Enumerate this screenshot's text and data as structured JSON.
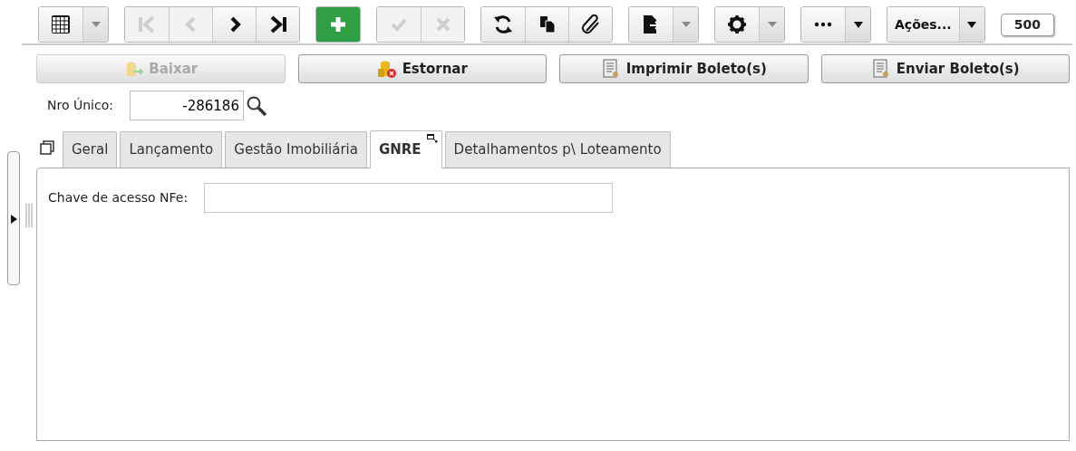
{
  "toolbar": [
    {
      "buttons": [
        {
          "kind": "icon",
          "disabled": false
        },
        {
          "kind": "caret",
          "disabled": false
        }
      ]
    },
    {
      "buttons": [
        {
          "kind": "icon",
          "disabled": true
        },
        {
          "kind": "icon",
          "disabled": true
        },
        {
          "kind": "icon",
          "disabled": false
        },
        {
          "kind": "icon",
          "disabled": false
        }
      ]
    },
    {
      "buttons": [
        {
          "kind": "icon",
          "disabled": false
        }
      ]
    },
    {
      "buttons": [
        {
          "kind": "icon",
          "disabled": true
        },
        {
          "kind": "icon",
          "disabled": true
        }
      ]
    },
    {
      "buttons": [
        {
          "kind": "icon",
          "disabled": false
        },
        {
          "kind": "icon",
          "disabled": false
        },
        {
          "kind": "icon",
          "disabled": false
        }
      ]
    },
    {
      "buttons": [
        {
          "kind": "icon",
          "disabled": false
        },
        {
          "kind": "caret",
          "disabled": false
        }
      ]
    },
    {
      "buttons": [
        {
          "kind": "icon",
          "disabled": false
        },
        {
          "kind": "caret",
          "disabled": false
        }
      ]
    },
    {
      "buttons": [
        {
          "kind": "icon",
          "disabled": false
        },
        {
          "kind": "caret-dark",
          "disabled": false
        }
      ]
    },
    {
      "buttons": [
        {
          "kind": "text",
          "label": "Ações...",
          "disabled": false
        },
        {
          "kind": "caret-dark",
          "disabled": false
        }
      ]
    }
  ],
  "record_count": "500",
  "actions": [
    {
      "label": "Baixar",
      "disabled": true
    },
    {
      "label": "Estornar",
      "disabled": false
    },
    {
      "label": "Imprimir Boleto(s)",
      "disabled": false
    },
    {
      "label": "Enviar Boleto(s)",
      "disabled": false
    }
  ],
  "nro_unico": {
    "label": "Nro Único:",
    "value": "-286186"
  },
  "tabs": [
    {
      "label": "Geral",
      "selected": false
    },
    {
      "label": "Lançamento",
      "selected": false
    },
    {
      "label": "Gestão Imobiliária",
      "selected": false
    },
    {
      "label": "GNRE",
      "selected": true
    },
    {
      "label": "Detalhamentos p\\ Loteamento",
      "selected": false
    }
  ],
  "fields": [
    {
      "label": "Chave de acesso NFe:"
    }
  ]
}
